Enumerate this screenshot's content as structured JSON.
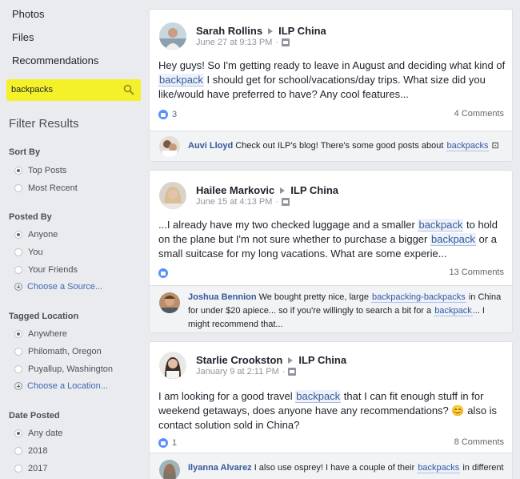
{
  "sidebar": {
    "nav": [
      "Photos",
      "Files",
      "Recommendations"
    ],
    "search_value": "backpacks",
    "filter_title": "Filter Results",
    "sort_by": {
      "title": "Sort By",
      "options": [
        "Top Posts",
        "Most Recent"
      ]
    },
    "posted_by": {
      "title": "Posted By",
      "options": [
        "Anyone",
        "You",
        "Your Friends"
      ],
      "choose": "Choose a Source..."
    },
    "tagged_location": {
      "title": "Tagged Location",
      "options": [
        "Anywhere",
        "Philomath, Oregon",
        "Puyallup, Washington"
      ],
      "choose": "Choose a Location..."
    },
    "date_posted": {
      "title": "Date Posted",
      "options": [
        "Any date",
        "2018",
        "2017"
      ]
    }
  },
  "posts": [
    {
      "author": "Sarah Rollins",
      "group": "ILP China",
      "date": "June 27 at 9:13 PM",
      "text": [
        {
          "t": "Hey guys! So I'm getting ready to leave in August and deciding what kind of "
        },
        {
          "t": "backpack",
          "hl": true
        },
        {
          "t": " I should get for school/vacations/day trips. What size did you like/would have preferred to have? Any cool features..."
        }
      ],
      "likes": "3",
      "comments": "4 Comments",
      "comment": {
        "name": "Auvi Lloyd",
        "text": [
          {
            "t": "Check out ILP's blog! There's some good posts about "
          },
          {
            "t": "backpacks",
            "hl": true
          },
          {
            "t": " ⊡"
          }
        ]
      }
    },
    {
      "author": "Hailee Markovic",
      "group": "ILP China",
      "date": "June 15 at 4:13 PM",
      "text": [
        {
          "t": "...I already have my two checked luggage and a smaller "
        },
        {
          "t": "backpack",
          "hl": true
        },
        {
          "t": " to hold on the plane but I'm not sure whether to purchase a bigger "
        },
        {
          "t": "backpack",
          "hl": true
        },
        {
          "t": " or a small suitcase for my long vacations. What are some experie..."
        }
      ],
      "likes": "",
      "comments": "13 Comments",
      "comment": {
        "name": "Joshua Bennion",
        "text": [
          {
            "t": "We bought pretty nice, large "
          },
          {
            "t": "backpacking-backpacks",
            "hl": true
          },
          {
            "t": " in China for under $20 apiece... so if you're willingly to search a bit for a "
          },
          {
            "t": "backpack",
            "hl": true
          },
          {
            "t": "... I might recommend that..."
          }
        ]
      }
    },
    {
      "author": "Starlie Crookston",
      "group": "ILP China",
      "date": "January 9 at 2:11 PM",
      "text": [
        {
          "t": "I am looking for a good travel "
        },
        {
          "t": "backpack",
          "hl": true
        },
        {
          "t": " that I can fit enough stuff in for weekend getaways, does anyone have any recommendations? 😊 also is contact solution sold in China?"
        }
      ],
      "likes": "1",
      "comments": "8 Comments",
      "comment": {
        "name": "Ilyanna Alvarez",
        "text": [
          {
            "t": "I also use osprey! I have a couple of their "
          },
          {
            "t": "backpacks",
            "hl": true
          },
          {
            "t": " in different"
          }
        ]
      }
    }
  ]
}
